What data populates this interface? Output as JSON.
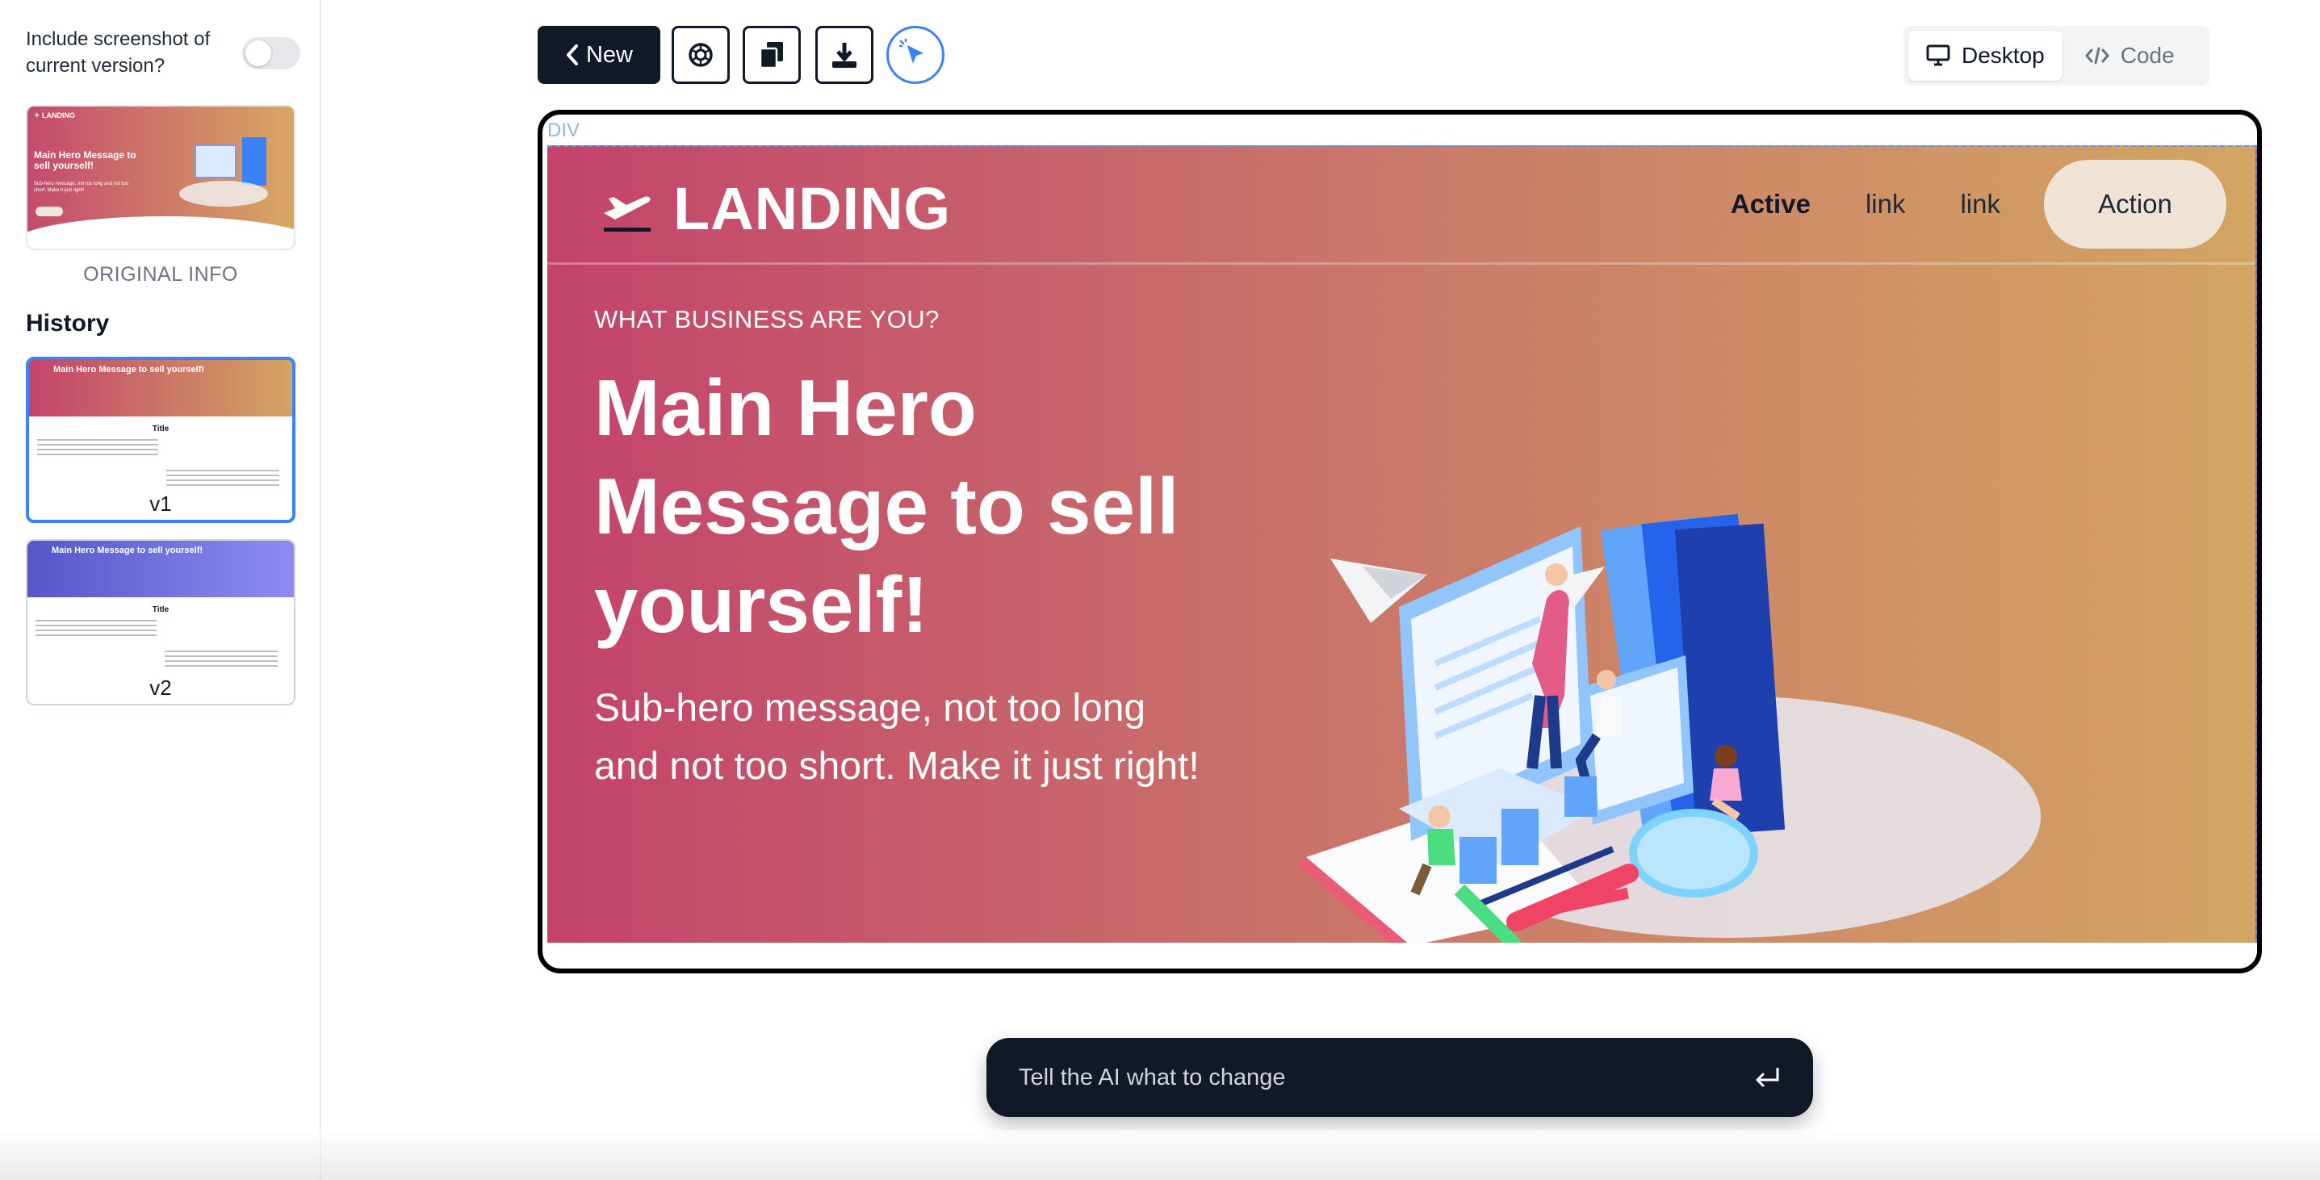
{
  "sidebar": {
    "toggle_label": "Include screenshot of current version?",
    "original_caption": "ORIGINAL INFO",
    "history_title": "History",
    "history": [
      {
        "label": "v1",
        "hero_text": "Main Hero Message to sell yourself!",
        "title": "Title",
        "color_from": "#c3436b",
        "color_to": "#d3a562"
      },
      {
        "label": "v2",
        "hero_text": "Main Hero Message to sell yourself!",
        "title": "Title",
        "color_from": "#5457c9",
        "color_to": "#8c8cf2"
      }
    ],
    "thumb": {
      "logo": "✈ LANDING",
      "message": "Main Hero Message to sell yourself!",
      "sub": "Sub-hero message, not too long and not too short. Make it just right!"
    }
  },
  "toolbar": {
    "new_label": "New",
    "icons": [
      "openai-icon",
      "copy-icon",
      "download-icon",
      "select-cursor-icon"
    ],
    "views": [
      {
        "label": "Desktop",
        "icon": "desktop-icon",
        "active": true
      },
      {
        "label": "Code",
        "icon": "code-icon",
        "active": false
      }
    ]
  },
  "preview": {
    "div_tag": "DIV",
    "logo": "LANDING",
    "nav": {
      "active": "Active",
      "link1": "link",
      "link2": "link",
      "action": "Action"
    },
    "eyebrow": "WHAT BUSINESS ARE YOU?",
    "title": "Main Hero Message to sell yourself!",
    "subtitle": "Sub-hero message, not too long and not too short. Make it just right!",
    "gradient": [
      "#c3436b",
      "#c9746a",
      "#d3a562"
    ]
  },
  "prompt": {
    "placeholder": "Tell the AI what to change"
  }
}
